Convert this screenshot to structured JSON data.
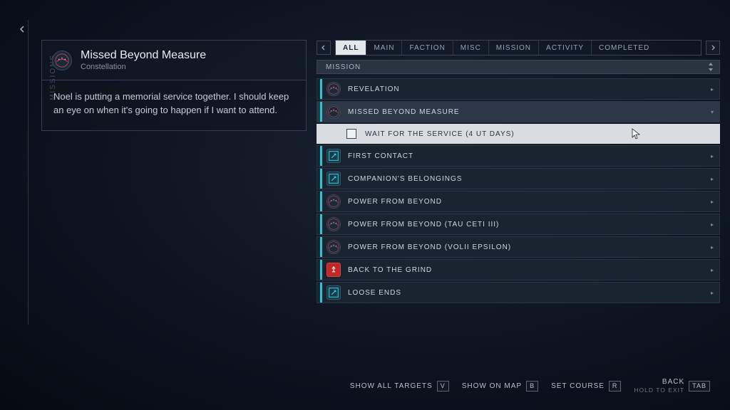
{
  "sideTab": {
    "label": "MISSIONS"
  },
  "detail": {
    "title": "Missed Beyond Measure",
    "faction": "Constellation",
    "description": "Noel is putting a memorial service together. I should keep an eye on when it's going to happen if I want to attend."
  },
  "tabs": {
    "items": [
      "ALL",
      "MAIN",
      "FACTION",
      "MISC",
      "MISSION",
      "ACTIVITY",
      "COMPLETED"
    ],
    "activeIndex": 0
  },
  "listHeader": "MISSION",
  "missions": [
    {
      "label": "REVELATION",
      "iconType": "constellation",
      "expanded": false
    },
    {
      "label": "MISSED BEYOND MEASURE",
      "iconType": "constellation",
      "expanded": true,
      "selected": true,
      "objectives": [
        {
          "label": "WAIT FOR THE SERVICE (4 UT DAYS)",
          "checked": false
        }
      ]
    },
    {
      "label": "FIRST CONTACT",
      "iconType": "misc",
      "expanded": false
    },
    {
      "label": "COMPANION'S BELONGINGS",
      "iconType": "misc",
      "expanded": false
    },
    {
      "label": "POWER FROM BEYOND",
      "iconType": "constellation",
      "expanded": false
    },
    {
      "label": "POWER FROM BEYOND (TAU CETI III)",
      "iconType": "constellation",
      "expanded": false
    },
    {
      "label": "POWER FROM BEYOND (VOLII EPSILON)",
      "iconType": "constellation",
      "expanded": false
    },
    {
      "label": "BACK TO THE GRIND",
      "iconType": "red",
      "expanded": false
    },
    {
      "label": "LOOSE ENDS",
      "iconType": "misc",
      "expanded": false
    }
  ],
  "footer": {
    "showAllTargets": {
      "label": "SHOW ALL TARGETS",
      "key": "V"
    },
    "showOnMap": {
      "label": "SHOW ON MAP",
      "key": "B"
    },
    "setCourse": {
      "label": "SET COURSE",
      "key": "R"
    },
    "back": {
      "label": "BACK",
      "sub": "HOLD TO EXIT",
      "key": "TAB"
    }
  }
}
